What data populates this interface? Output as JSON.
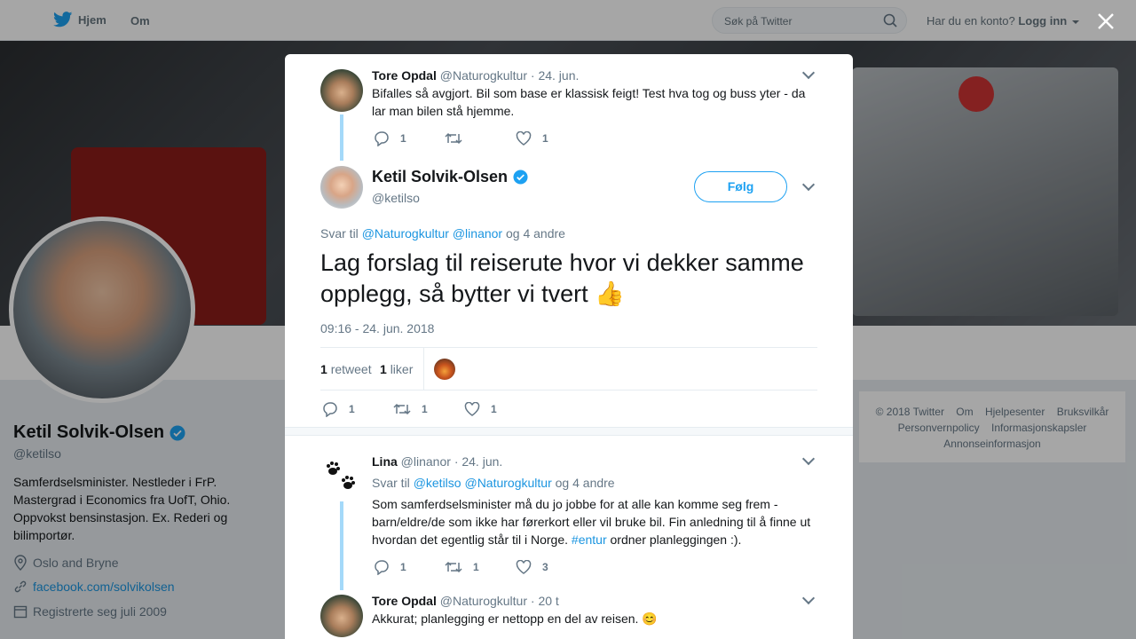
{
  "nav": {
    "home": "Hjem",
    "about": "Om",
    "search_placeholder": "Søk på Twitter",
    "account_question": "Har du en konto?",
    "login": "Logg inn"
  },
  "profile": {
    "name": "Ketil Solvik-Olsen",
    "handle": "@ketilso",
    "bio": "Samferdselsminister. Nestleder i FrP. Mastergrad i Economics fra UofT, Ohio. Oppvokst bensinstasjon. Ex. Rederi og bilimportør.",
    "location": "Oslo and Bryne",
    "website": "facebook.com/solvikolsen",
    "joined": "Registrerte seg juli 2009"
  },
  "footer": {
    "items": [
      "© 2018 Twitter",
      "Om",
      "Hjelpesenter",
      "Bruksvilkår",
      "Personvernpolicy",
      "Informasjonskapsler",
      "Annonseinformasjon"
    ]
  },
  "modal": {
    "parent_tweet": {
      "name": "Tore Opdal",
      "handle": "@Naturogkultur",
      "date": "· 24. jun.",
      "text": "Bifalles så avgjort. Bil som base er klassisk feigt! Test hva tog og buss yter - da lar man bilen stå hjemme.",
      "replies": "1",
      "retweets": "",
      "likes": "1"
    },
    "main_tweet": {
      "name": "Ketil Solvik-Olsen",
      "handle": "@ketilso",
      "follow": "Følg",
      "reply_prefix": "Svar til",
      "reply_user1": "@Naturogkultur",
      "reply_user2": "@linanor",
      "reply_suffix": "og 4 andre",
      "text": "Lag forslag til reiserute hvor vi dekker samme opplegg, så bytter vi tvert 👍",
      "timestamp": "09:16 - 24. jun. 2018",
      "retweet_count": "1",
      "retweet_label": "retweet",
      "like_count": "1",
      "like_label": "liker",
      "replies": "1",
      "retweets": "1",
      "likes": "1"
    },
    "reply1": {
      "name": "Lina",
      "handle": "@linanor",
      "date": "· 24. jun.",
      "reply_prefix": "Svar til",
      "reply_user1": "@ketilso",
      "reply_user2": "@Naturogkultur",
      "reply_suffix": "og 4 andre",
      "text_before": "Som samferdselsminister må du jo jobbe for at alle kan komme seg frem - barn/eldre/de som ikke har førerkort eller vil bruke bil. Fin anledning til å finne ut hvordan det egentlig står til i Norge.",
      "hashtag": "#entur",
      "text_after": "ordner planleggingen :).",
      "replies": "1",
      "retweets": "1",
      "likes": "3"
    },
    "reply2": {
      "name": "Tore Opdal",
      "handle": "@Naturogkultur",
      "date": "· 20 t",
      "text": "Akkurat; planlegging er nettopp en del av reisen. 😊"
    }
  },
  "colors": {
    "accent": "#1da1f2",
    "link": "#1b95e0",
    "thread_line": "#a4d9f9"
  }
}
